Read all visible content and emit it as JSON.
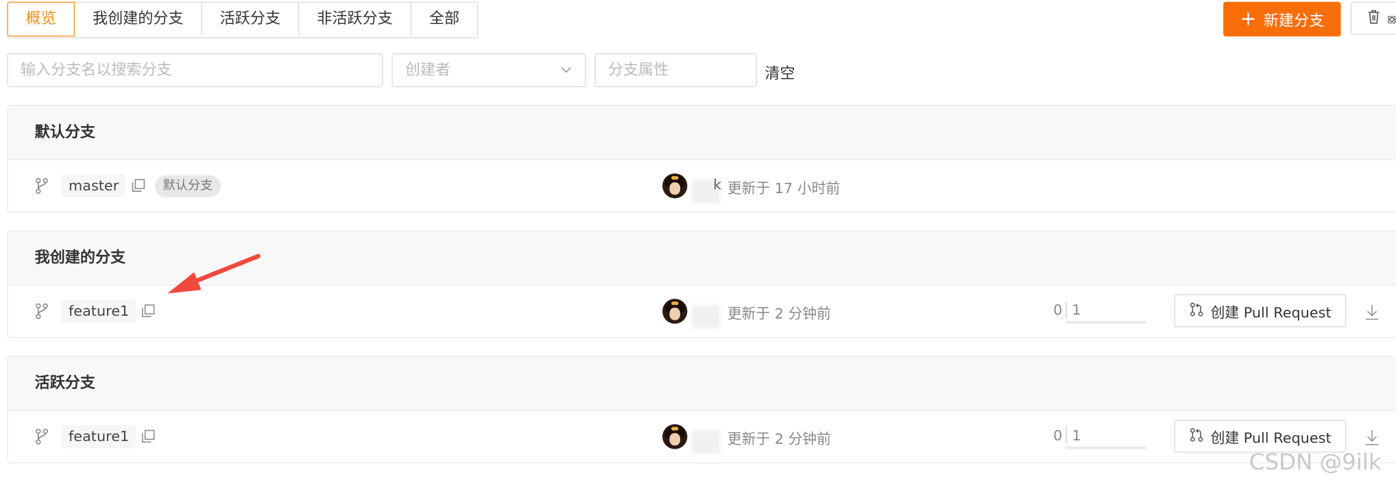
{
  "tabs": [
    {
      "label": "概览",
      "active": true
    },
    {
      "label": "我创建的分支",
      "active": false
    },
    {
      "label": "活跃分支",
      "active": false
    },
    {
      "label": "非活跃分支",
      "active": false
    },
    {
      "label": "全部",
      "active": false
    }
  ],
  "actions": {
    "new_branch_label": "新建分支",
    "delete_label": "⧇"
  },
  "filters": {
    "search_placeholder": "输入分支名以搜索分支",
    "creator_placeholder": "创建者",
    "attribute_placeholder": "分支属性",
    "clear_label": "清空"
  },
  "sections": {
    "default": {
      "title": "默认分支",
      "row": {
        "branch": "master",
        "badge": "默认分支",
        "author_fragment": "k",
        "updated": "更新于 17 小时前"
      }
    },
    "mine": {
      "title": "我创建的分支",
      "row": {
        "branch": "feature1",
        "updated": "更新于 2 分钟前",
        "behind": "0",
        "ahead": "1",
        "pr_label": "创建 Pull Request"
      }
    },
    "active": {
      "title": "活跃分支",
      "row": {
        "branch": "feature1",
        "updated": "更新于 2 分钟前",
        "behind": "0",
        "ahead": "1",
        "pr_label": "创建 Pull Request"
      }
    }
  },
  "watermark": "CSDN @9ilk",
  "colors": {
    "accent": "#fa6e0a",
    "annotation_arrow": "#f04a3e"
  }
}
